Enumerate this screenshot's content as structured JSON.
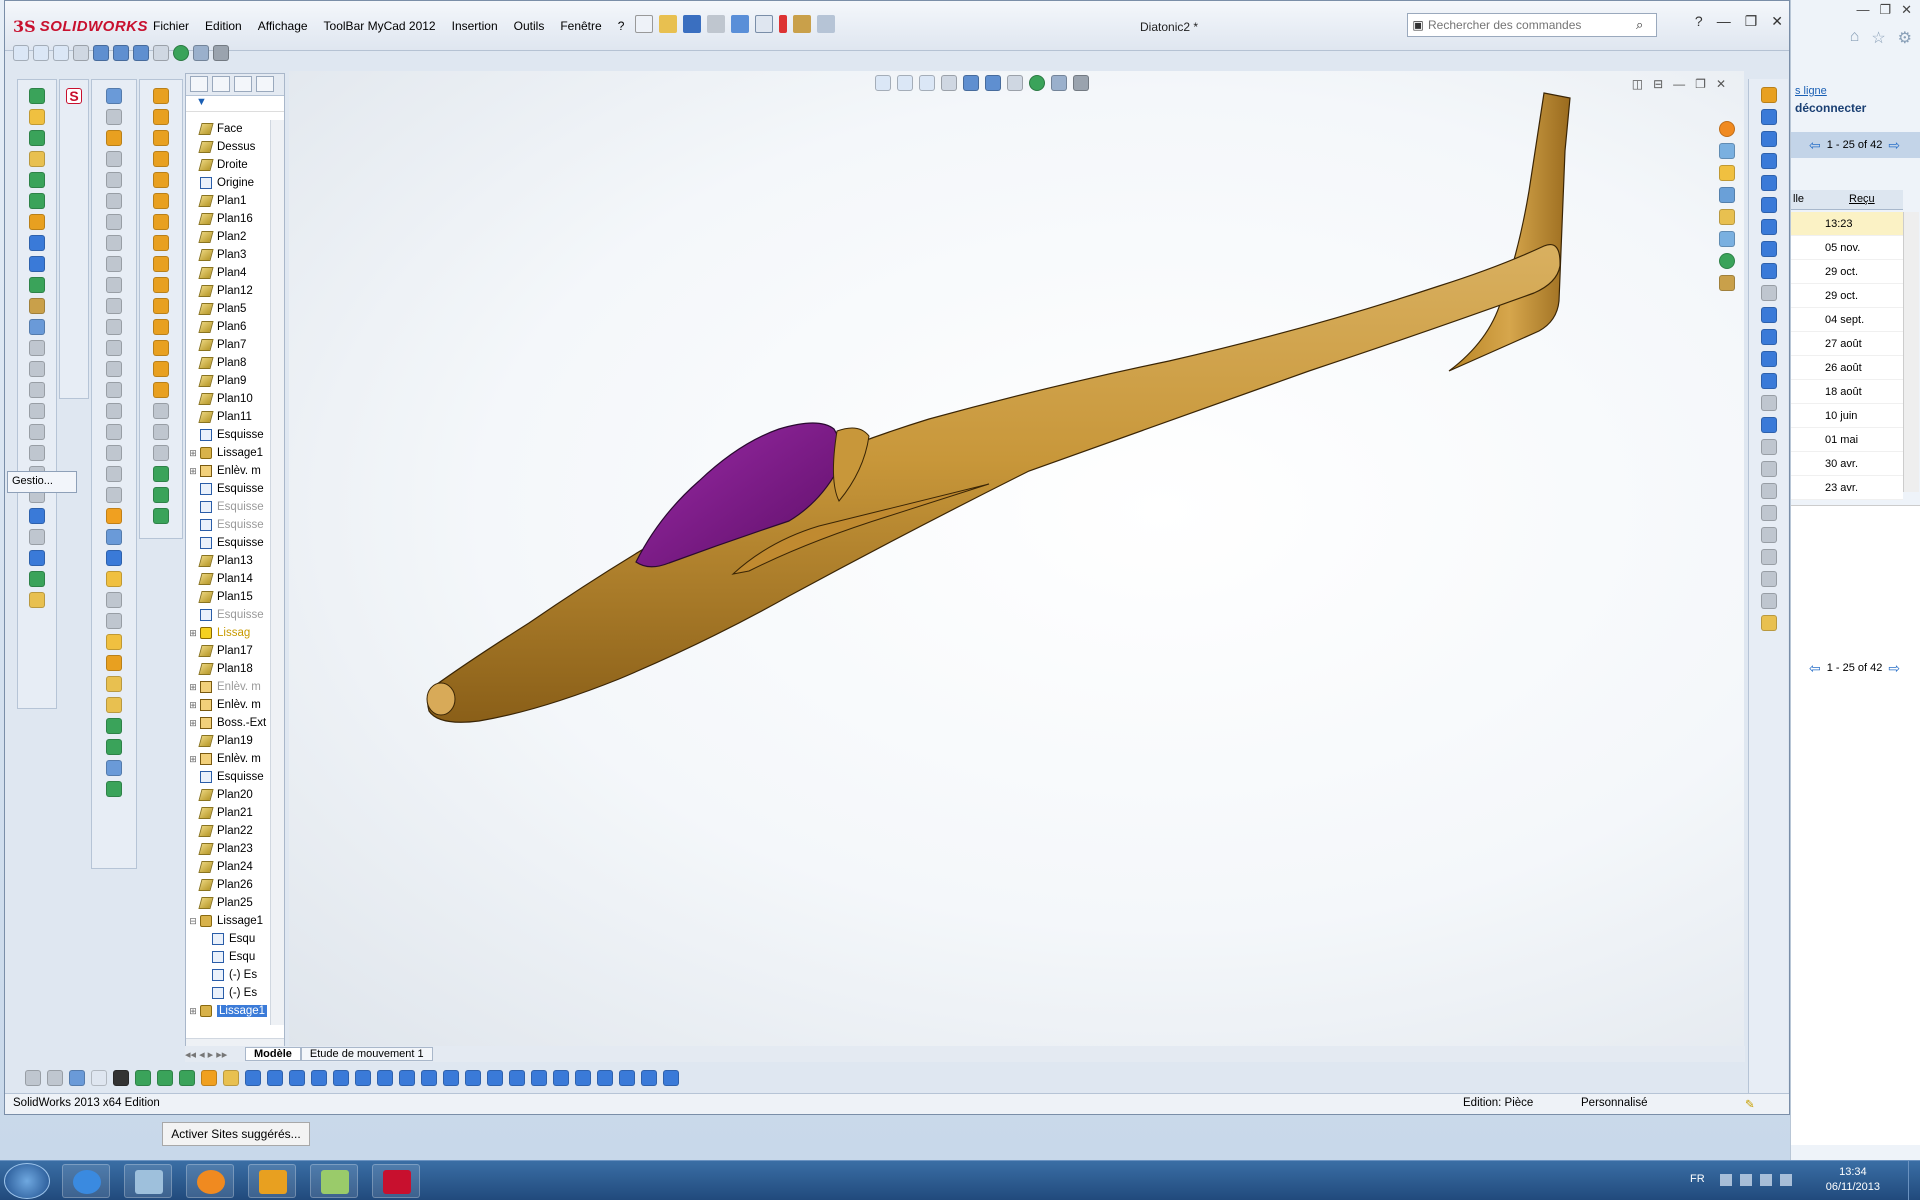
{
  "background_browser": {
    "link_text": "s ligne",
    "disconnect_text": "déconnecter",
    "pager_top": "1 - 25 of 42",
    "pager_bottom": "1 - 25 of 42",
    "col_partial": "lle",
    "col_received": "Reçu",
    "dates": [
      "13:23",
      "05 nov.",
      "29 oct.",
      "29 oct.",
      "04 sept.",
      "27 août",
      "26 août",
      "18 août",
      "10 juin",
      "01 mai",
      "30 avr.",
      "23 avr."
    ]
  },
  "window": {
    "brand_ds": "3S",
    "brand_name": "SOLIDWORKS",
    "document_title": "Diatonic2 *",
    "search_placeholder": "Rechercher des commandes"
  },
  "menu": [
    "Fichier",
    "Edition",
    "Affichage",
    "ToolBar MyCad 2012",
    "Insertion",
    "Outils",
    "Fenêtre",
    "?"
  ],
  "gestion_tab": "Gestio...",
  "tree": [
    {
      "label": "Face",
      "icon": "plane"
    },
    {
      "label": "Dessus",
      "icon": "plane"
    },
    {
      "label": "Droite",
      "icon": "plane"
    },
    {
      "label": "Origine",
      "icon": "origin"
    },
    {
      "label": "Plan1",
      "icon": "plane"
    },
    {
      "label": "Plan16",
      "icon": "plane"
    },
    {
      "label": "Plan2",
      "icon": "plane"
    },
    {
      "label": "Plan3",
      "icon": "plane"
    },
    {
      "label": "Plan4",
      "icon": "plane"
    },
    {
      "label": "Plan12",
      "icon": "plane"
    },
    {
      "label": "Plan5",
      "icon": "plane"
    },
    {
      "label": "Plan6",
      "icon": "plane"
    },
    {
      "label": "Plan7",
      "icon": "plane"
    },
    {
      "label": "Plan8",
      "icon": "plane"
    },
    {
      "label": "Plan9",
      "icon": "plane"
    },
    {
      "label": "Plan10",
      "icon": "plane"
    },
    {
      "label": "Plan11",
      "icon": "plane"
    },
    {
      "label": "Esquisse",
      "icon": "sketch"
    },
    {
      "label": "Lissage1",
      "icon": "feat",
      "expand": "+"
    },
    {
      "label": "Enlèv. m",
      "icon": "cut",
      "expand": "+"
    },
    {
      "label": "Esquisse",
      "icon": "sketch"
    },
    {
      "label": "Esquisse",
      "icon": "sketch",
      "dim": true
    },
    {
      "label": "Esquisse",
      "icon": "sketch",
      "dim": true
    },
    {
      "label": "Esquisse",
      "icon": "sketch"
    },
    {
      "label": "Plan13",
      "icon": "plane"
    },
    {
      "label": "Plan14",
      "icon": "plane"
    },
    {
      "label": "Plan15",
      "icon": "plane"
    },
    {
      "label": "Esquisse",
      "icon": "sketch",
      "dim": true
    },
    {
      "label": "Lissag",
      "icon": "feat",
      "expand": "+",
      "warn": true
    },
    {
      "label": "Plan17",
      "icon": "plane"
    },
    {
      "label": "Plan18",
      "icon": "plane"
    },
    {
      "label": "Enlèv. m",
      "icon": "cut",
      "expand": "+",
      "dim": true
    },
    {
      "label": "Enlèv. m",
      "icon": "cut",
      "expand": "+"
    },
    {
      "label": "Boss.-Ext",
      "icon": "cut",
      "expand": "+"
    },
    {
      "label": "Plan19",
      "icon": "plane"
    },
    {
      "label": "Enlèv. m",
      "icon": "cut",
      "expand": "+"
    },
    {
      "label": "Esquisse",
      "icon": "sketch"
    },
    {
      "label": "Plan20",
      "icon": "plane"
    },
    {
      "label": "Plan21",
      "icon": "plane"
    },
    {
      "label": "Plan22",
      "icon": "plane"
    },
    {
      "label": "Plan23",
      "icon": "plane"
    },
    {
      "label": "Plan24",
      "icon": "plane"
    },
    {
      "label": "Plan26",
      "icon": "plane"
    },
    {
      "label": "Plan25",
      "icon": "plane"
    },
    {
      "label": "Lissage1",
      "icon": "feat",
      "expand": "−"
    },
    {
      "label": "Esqu",
      "icon": "sketch",
      "indent": true
    },
    {
      "label": "Esqu",
      "icon": "sketch",
      "indent": true
    },
    {
      "label": "(-) Es",
      "icon": "sketch",
      "indent": true
    },
    {
      "label": "(-) Es",
      "icon": "sketch",
      "indent": true
    },
    {
      "label": "Lissage1",
      "icon": "feat",
      "expand": "+",
      "selected": true
    }
  ],
  "model_tabs": [
    "Modèle",
    "Etude de mouvement 1"
  ],
  "status": {
    "left": "SolidWorks 2013 x64 Edition",
    "mode": "Edition: Pièce",
    "custom": "Personnalisé"
  },
  "activer_button": "Activer Sites suggérés...",
  "tray": {
    "lang": "FR",
    "time": "13:34",
    "date": "06/11/2013"
  },
  "colors": {
    "fuselage": "#c8973a",
    "canopy": "#7d1a86",
    "accent_red": "#c8102e"
  }
}
